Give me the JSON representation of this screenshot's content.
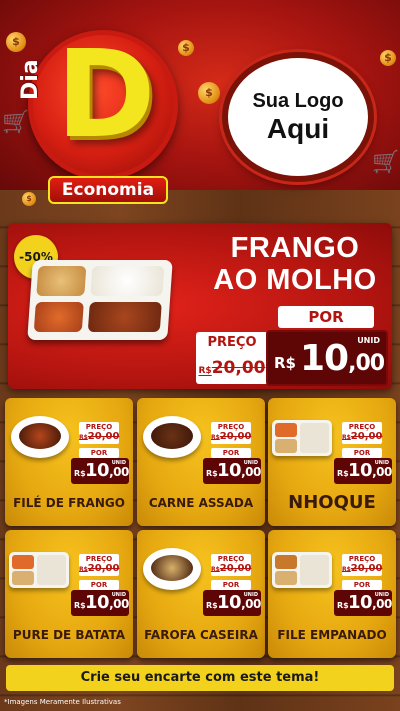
{
  "header": {
    "dia_label": "Dia",
    "d_letter": "D",
    "economia_label": "Economia",
    "coin_symbol": "$",
    "logo_line1": "Sua Logo",
    "logo_line2": "Aqui"
  },
  "featured": {
    "discount": "-50%",
    "title_line1": "FRANGO",
    "title_line2": "AO MOLHO",
    "por_label": "POR",
    "preco_label": "PREÇO",
    "old_currency": "R$",
    "old_price": "20,00",
    "new_currency": "R$",
    "new_price_int": "10",
    "new_price_cents": ",00",
    "unit": "UNID"
  },
  "labels": {
    "preco": "PREÇO",
    "por": "POR",
    "unid": "UNID",
    "currency": "R$",
    "old_price": "20,00",
    "new_int": "10",
    "new_cents": ",00"
  },
  "products": [
    {
      "name": "FILÉ DE FRANGO",
      "food": "bowl",
      "color": "#b5451c"
    },
    {
      "name": "CARNE ASSADA",
      "food": "bowl",
      "color": "#6a3216"
    },
    {
      "name": "NHOQUE",
      "food": "tray",
      "color": "#e06a2a"
    },
    {
      "name": "PURE DE BATATA",
      "food": "tray",
      "color": "#e06a2a"
    },
    {
      "name": "FAROFA CASEIRA",
      "food": "bowl",
      "color": "#d8b06a"
    },
    {
      "name": "FILE EMPANADO",
      "food": "tray",
      "color": "#c8782a"
    }
  ],
  "cta": "Crie seu encarte com este tema!",
  "footnote": "*Imagens Meramente Ilustrativas",
  "colors": {
    "red": "#b21510",
    "yellow": "#f3d21e",
    "dark_red": "#5e0606",
    "wood": "#6b3a1b"
  }
}
